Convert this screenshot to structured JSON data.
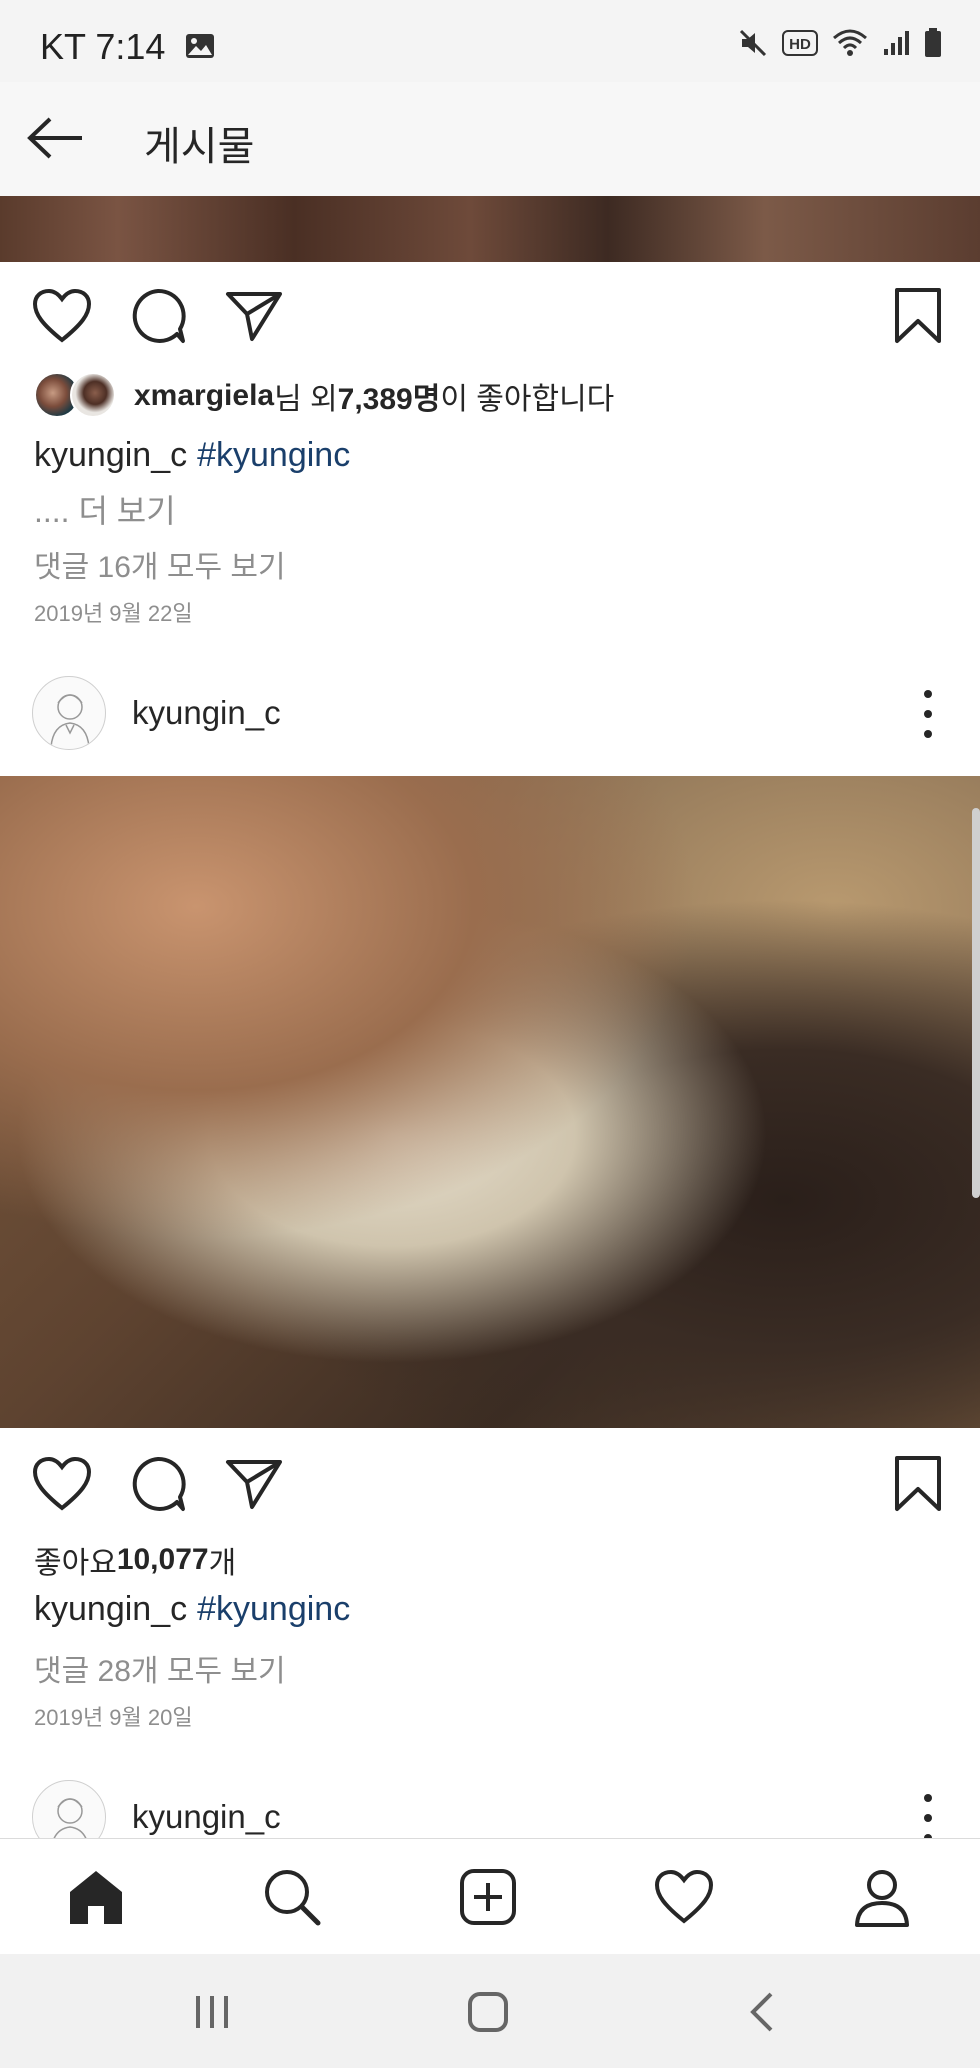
{
  "status_bar": {
    "carrier_time": "KT 7:14"
  },
  "header": {
    "title": "게시물"
  },
  "post1": {
    "likes_user": "xmargiela",
    "likes_mid": "님 외 ",
    "likes_count": "7,389명",
    "likes_tail": "이 좋아합니다",
    "caption_user": "kyungin_c",
    "caption_tag": "#kyunginc",
    "more": ".... 더 보기",
    "comments": "댓글 16개 모두 보기",
    "date": "2019년 9월 22일"
  },
  "post2": {
    "username": "kyungin_c",
    "likes_label": "좋아요 ",
    "likes_count": "10,077",
    "likes_unit": "개",
    "caption_user": "kyungin_c",
    "caption_tag": "#kyunginc",
    "comments": "댓글 28개 모두 보기",
    "date": "2019년 9월 20일"
  },
  "post3": {
    "username": "kyungin_c"
  },
  "icons": {
    "status": [
      "gallery-icon",
      "mute-icon",
      "hd-icon",
      "wifi-icon",
      "signal-icon",
      "battery-icon"
    ],
    "actions": [
      "heart-icon",
      "comment-icon",
      "send-icon",
      "bookmark-icon"
    ],
    "bottom_nav": [
      "home-icon",
      "search-icon",
      "add-post-icon",
      "activity-heart-icon",
      "profile-icon"
    ],
    "system_nav": [
      "recent-apps-icon",
      "home-button-icon",
      "back-chevron-icon"
    ]
  },
  "colors": {
    "hashtag": "#1a3f6b",
    "secondary_text": "#8e8e8e",
    "primary_text": "#262626"
  }
}
